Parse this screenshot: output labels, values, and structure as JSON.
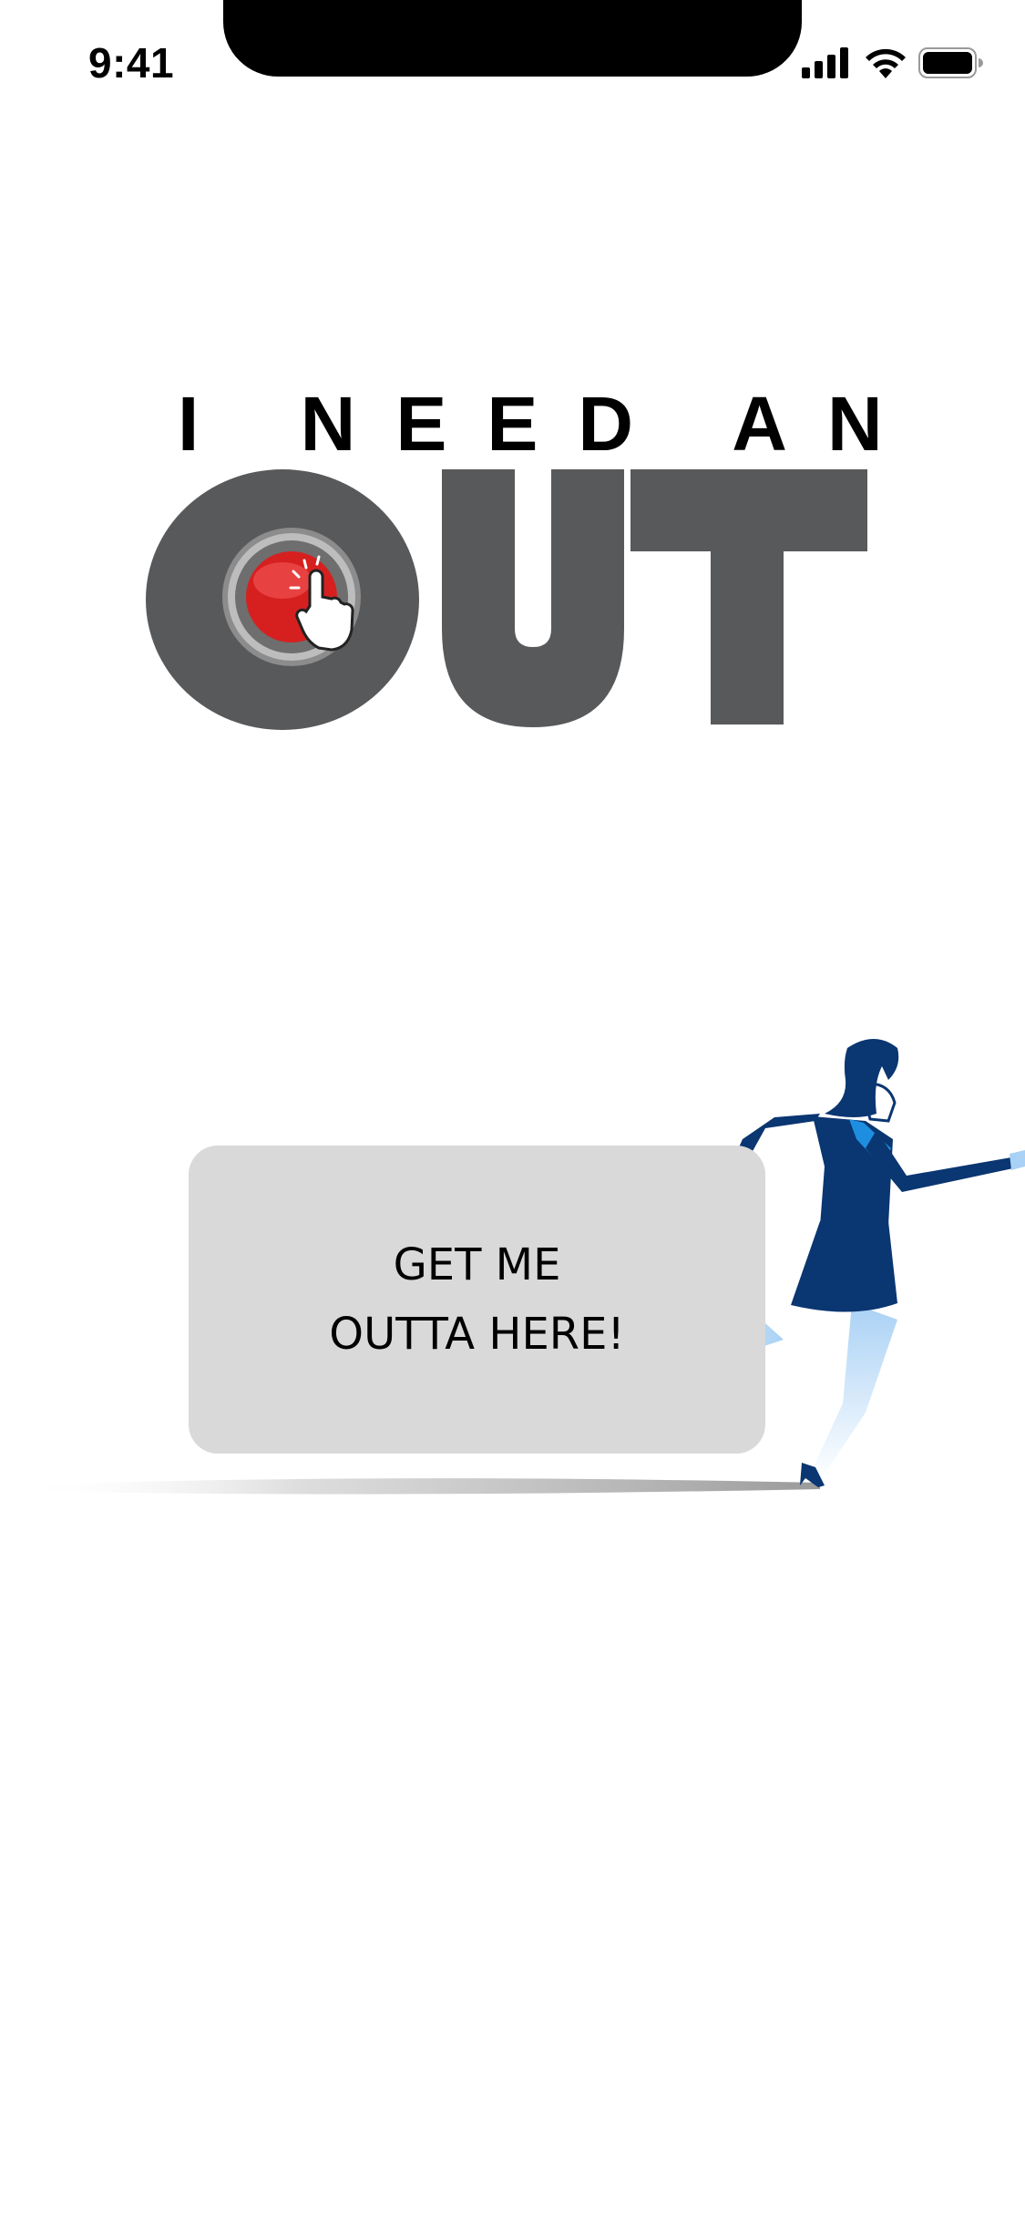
{
  "status_bar": {
    "time": "9:41",
    "icons": [
      "cellular-signal-icon",
      "wifi-icon",
      "battery-icon"
    ]
  },
  "logo": {
    "line1": "I NEED AN",
    "line2": "OUT",
    "icon": "red-panic-button-icon"
  },
  "cta": {
    "line1": "GET ME",
    "line2": "OUTTA HERE!"
  },
  "illustration": {
    "icon": "running-woman-illustration"
  },
  "colors": {
    "background": "#ffffff",
    "button_bg": "#d9d9d9",
    "logo_gray": "#58595b",
    "logo_red": "#e02020",
    "suit_navy": "#0a3671",
    "suit_blue": "#1e8fe0"
  }
}
